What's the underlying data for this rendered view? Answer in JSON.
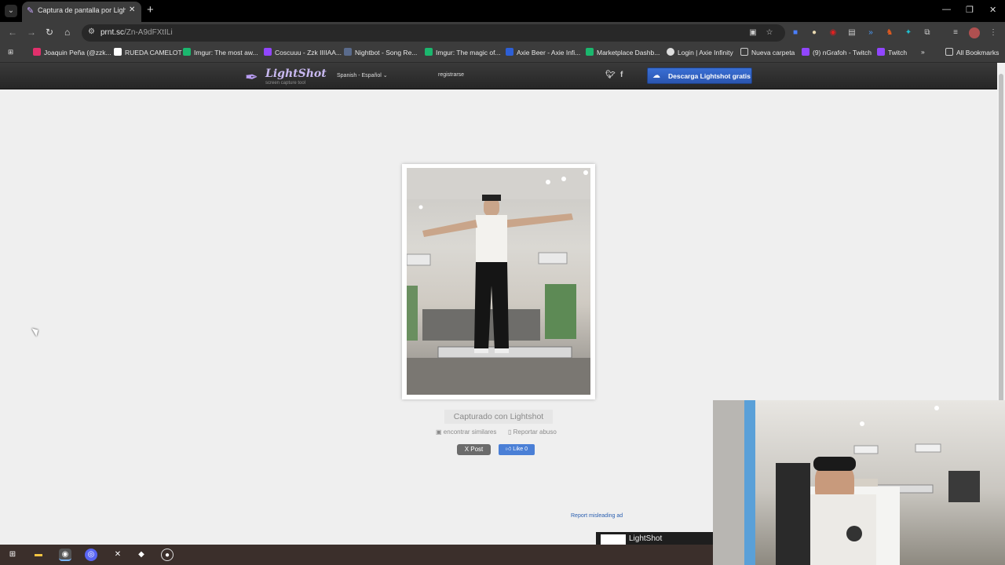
{
  "browser": {
    "tab_title": "Captura de pantalla por Lightshot",
    "url_host": "prnt.sc",
    "url_path": "/Zn-A9dFXtILi",
    "bookmarks": [
      {
        "label": "Joaquin Peña (@zzk...",
        "color": "#e1306c"
      },
      {
        "label": "RUEDA CAMELOT",
        "color": "#ffffff"
      },
      {
        "label": "Imgur: The most aw...",
        "color": "#1bb76e"
      },
      {
        "label": "Coscuuu - Zzk IIIIAA...",
        "color": "#9146ff"
      },
      {
        "label": "Nightbot - Song Re...",
        "color": "#5a6b8c"
      },
      {
        "label": "Imgur: The magic of...",
        "color": "#1bb76e"
      },
      {
        "label": "Axie Beer - Axie Infi...",
        "color": "#2d5fd6"
      },
      {
        "label": "Marketplace Dashb...",
        "color": "#1bb76e"
      },
      {
        "label": "Login | Axie Infinity",
        "color": "#dddddd"
      },
      {
        "label": "Nueva carpeta",
        "color": "#cccccc"
      },
      {
        "label": "(9) nGrafoh - Twitch",
        "color": "#9146ff"
      },
      {
        "label": "Twitch",
        "color": "#9146ff"
      }
    ],
    "all_bookmarks": "All Bookmarks"
  },
  "lightshot": {
    "logo_name": "LightShot",
    "logo_tagline": "screen capture tool",
    "language": "Spanish - Español",
    "register": "registrarse",
    "download_label": "Descarga Lightshot gratis",
    "caption": "Capturado con Lightshot",
    "find_similar": "encontrar similares",
    "report_abuse": "Reportar abuso",
    "post_label": "X Post",
    "like_label": "Like 0",
    "report_ad": "Report misleading ad",
    "ad_text": "LightShot"
  }
}
